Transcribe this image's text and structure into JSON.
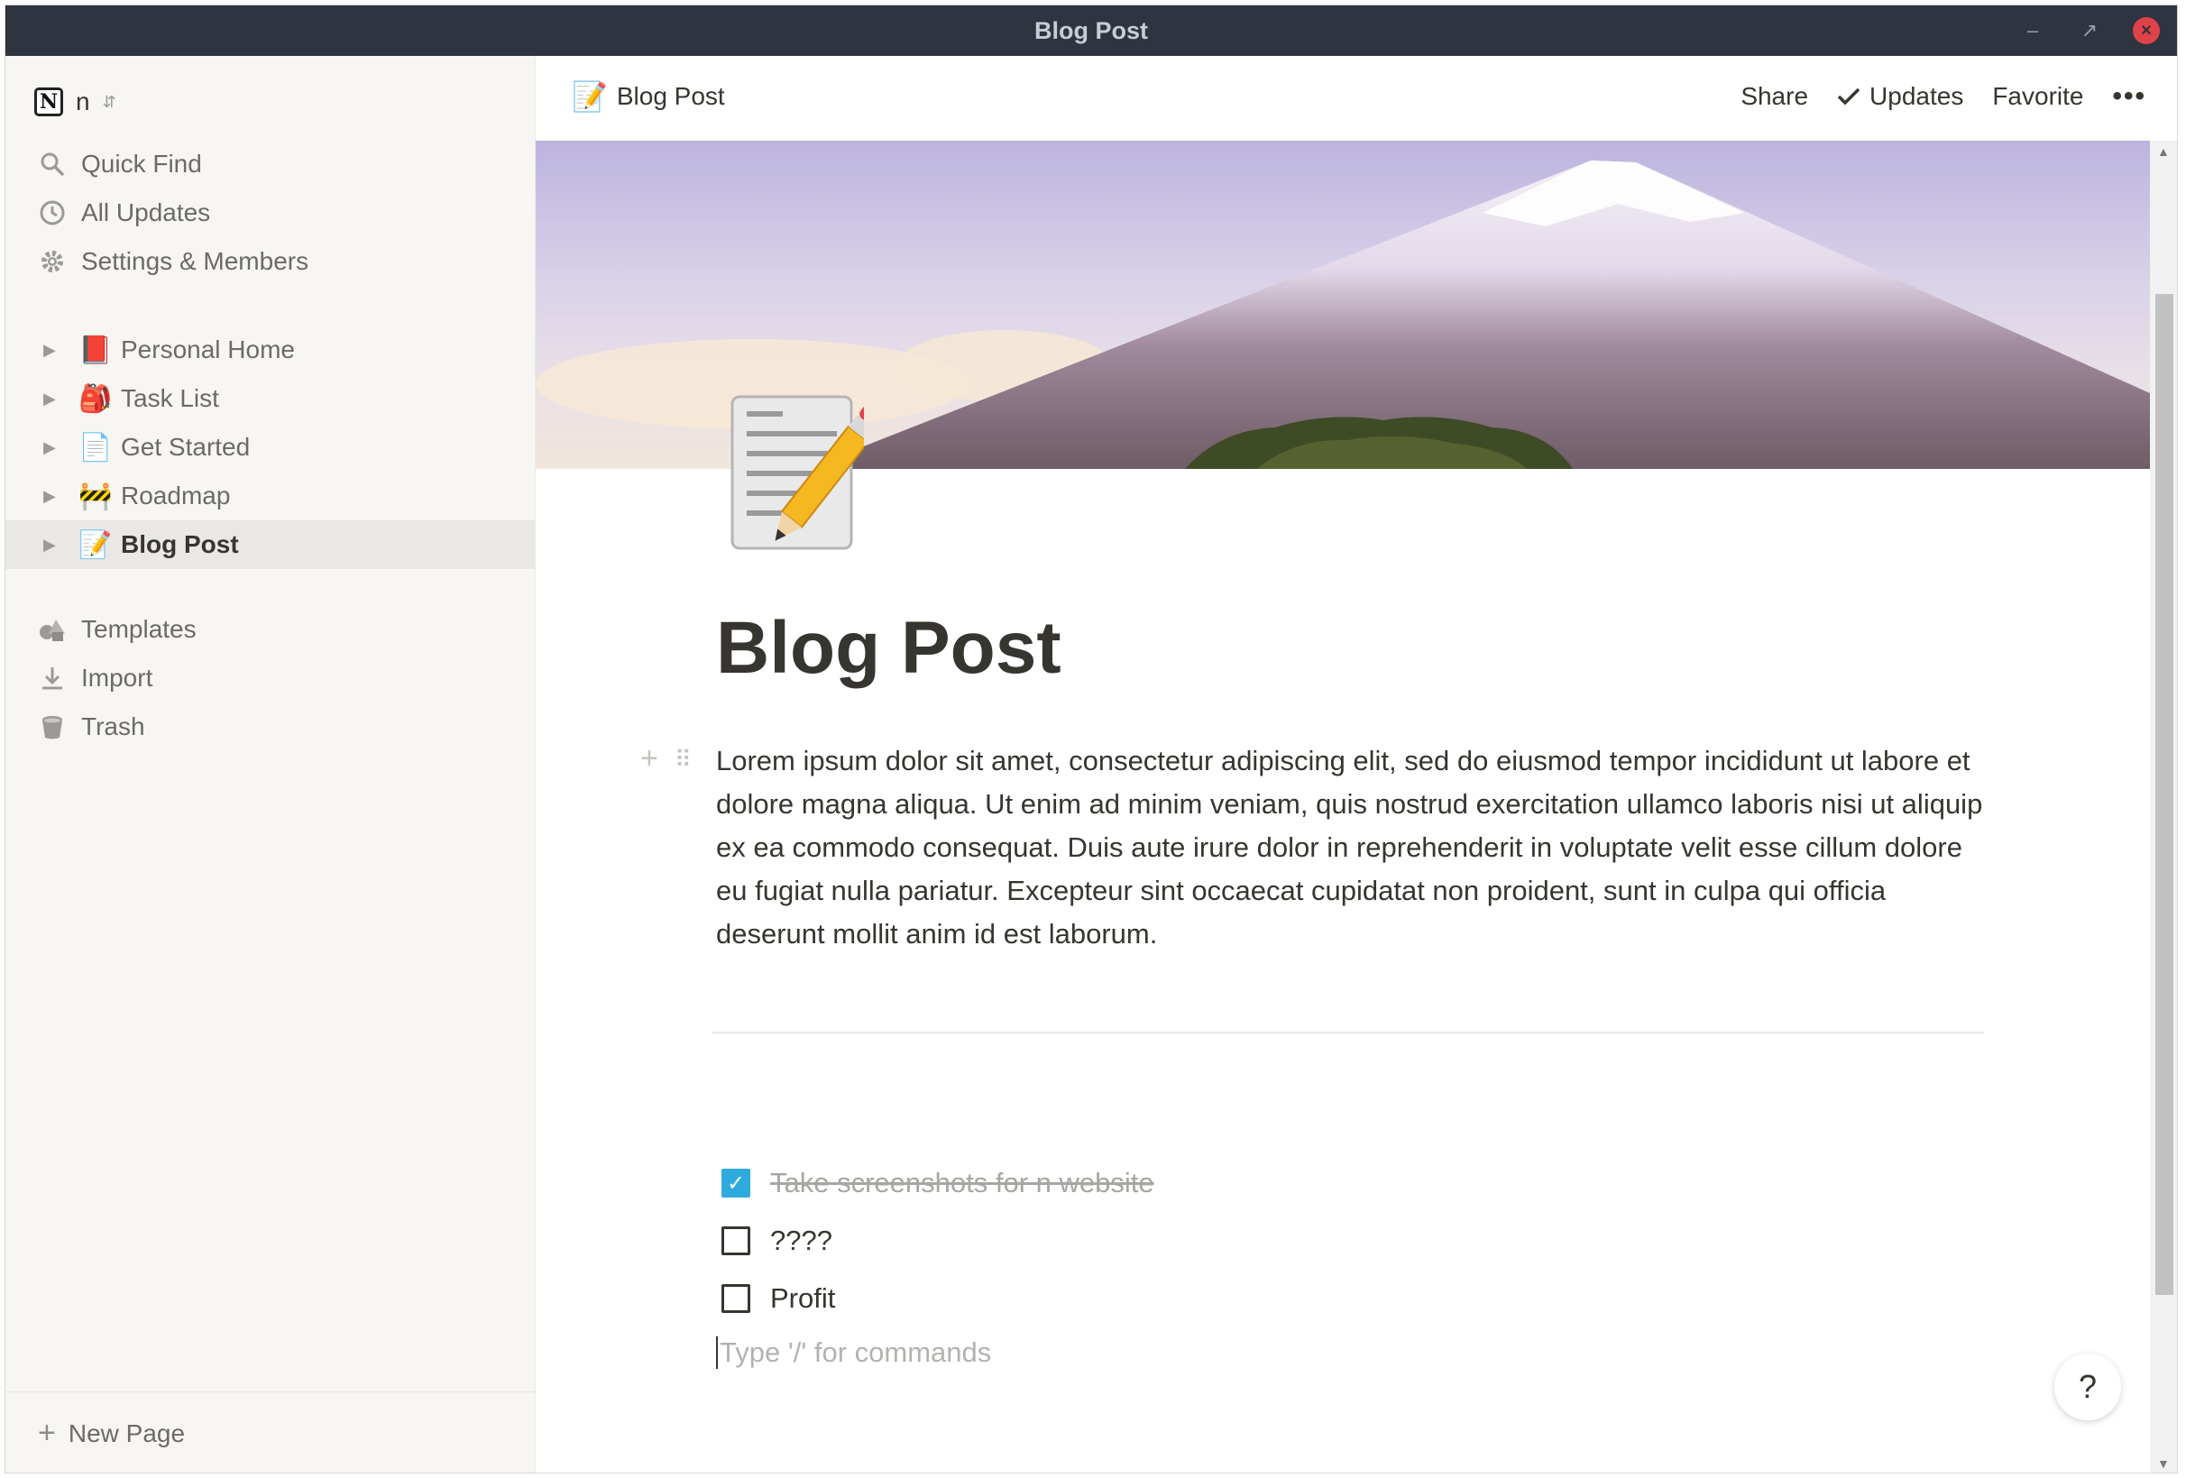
{
  "window": {
    "title": "Blog Post"
  },
  "workspace": {
    "name": "n",
    "logo_letter": "N"
  },
  "sidebar": {
    "nav": [
      {
        "label": "Quick Find",
        "icon": "search-icon"
      },
      {
        "label": "All Updates",
        "icon": "clock-icon"
      },
      {
        "label": "Settings & Members",
        "icon": "gear-icon"
      }
    ],
    "pages": [
      {
        "label": "Personal Home",
        "icon": "📕"
      },
      {
        "label": "Task List",
        "icon": "🎒"
      },
      {
        "label": "Get Started",
        "icon": "📄"
      },
      {
        "label": "Roadmap",
        "icon": "🚧"
      },
      {
        "label": "Blog Post",
        "icon": "📝",
        "active": true
      }
    ],
    "tools": [
      {
        "label": "Templates",
        "icon": "templates-icon"
      },
      {
        "label": "Import",
        "icon": "import-icon"
      },
      {
        "label": "Trash",
        "icon": "trash-icon"
      }
    ],
    "new_page": "New Page"
  },
  "topbar": {
    "breadcrumb": "Blog Post",
    "breadcrumb_icon": "📝",
    "share": "Share",
    "updates": "Updates",
    "favorite": "Favorite",
    "more": "•••"
  },
  "page": {
    "icon": "📝",
    "title": "Blog Post",
    "paragraph": "Lorem ipsum dolor sit amet, consectetur adipiscing elit, sed do eiusmod tempor incididunt ut labore et dolore magna aliqua. Ut enim ad minim veniam, quis nostrud exercitation ullamco laboris nisi ut aliquip ex ea commodo consequat. Duis aute irure dolor in reprehenderit in voluptate velit esse cillum dolore eu fugiat nulla pariatur. Excepteur sint occaecat cupidatat non proident, sunt in culpa qui officia deserunt mollit anim id est laborum.",
    "todos": [
      {
        "text": "Take screenshots for n website",
        "checked": true
      },
      {
        "text": "????",
        "checked": false
      },
      {
        "text": "Profit",
        "checked": false
      }
    ],
    "placeholder": "Type '/' for commands"
  },
  "help": "?",
  "colors": {
    "accent": "#2eaadc",
    "sidebar_bg": "#f7f6f3",
    "titlebar_bg": "#2e3440"
  }
}
